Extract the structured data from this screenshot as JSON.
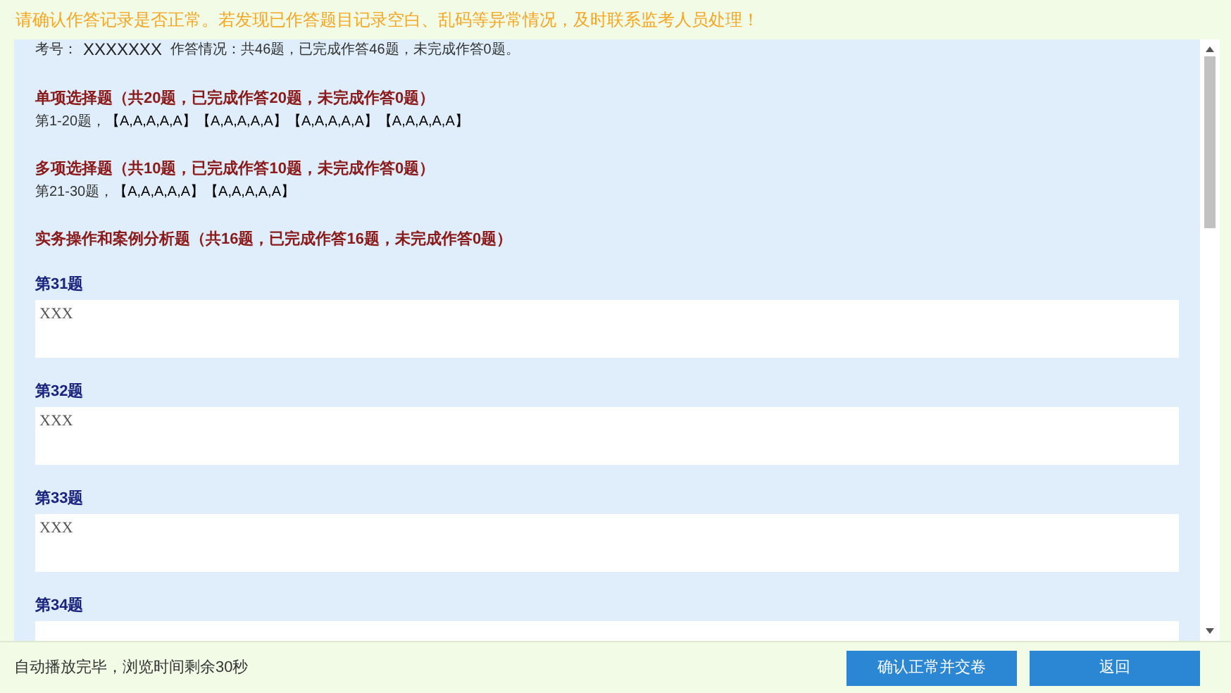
{
  "notice": "请确认作答记录是否正常。若发现已作答题目记录空白、乱码等异常情况，及时联系监考人员处理！",
  "summary": {
    "label": "考号：",
    "exam_number": "XXXXXXX",
    "status": "作答情况：共46题，已完成作答46题，未完成作答0题。"
  },
  "sections": [
    {
      "kind": "choice",
      "title": "单项选择题（共20题，已完成作答20题，未完成作答0题）",
      "range": "第1-20题，",
      "groups": [
        "【A,A,A,A,A】",
        "【A,A,A,A,A】",
        "【A,A,A,A,A】",
        "【A,A,A,A,A】"
      ]
    },
    {
      "kind": "choice",
      "title": "多项选择题（共10题，已完成作答10题，未完成作答0题）",
      "range": "第21-30题，",
      "groups": [
        "【A,A,A,A,A】",
        "【A,A,A,A,A】"
      ]
    },
    {
      "kind": "essay",
      "title": "实务操作和案例分析题（共16题，已完成作答16题，未完成作答0题）",
      "questions": [
        {
          "label": "第31题",
          "answer": "XXX"
        },
        {
          "label": "第32题",
          "answer": "XXX"
        },
        {
          "label": "第33题",
          "answer": "XXX"
        },
        {
          "label": "第34题"
        }
      ]
    }
  ],
  "footer": {
    "message": "自动播放完毕，浏览时间剩余30秒",
    "buttons": [
      "确认正常并交卷",
      "返回"
    ]
  }
}
